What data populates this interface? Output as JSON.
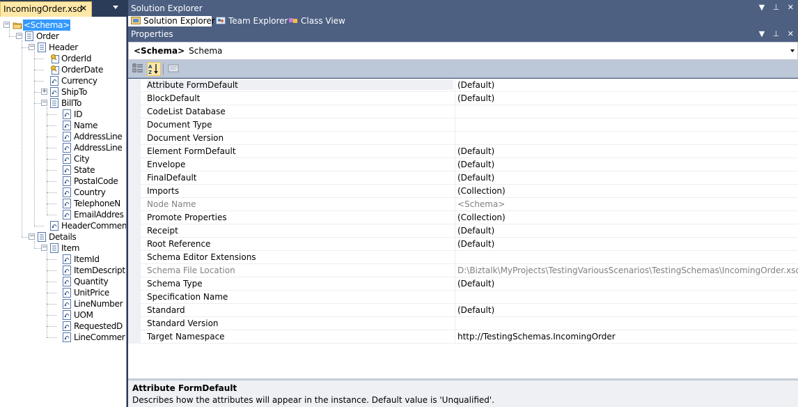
{
  "document": {
    "tab_label": "IncomingOrder.xsd",
    "tab_close": "✕"
  },
  "tree": [
    {
      "label": "<Schema>",
      "icon": "schema-folder-icon",
      "toggle": "−",
      "selected": true
    },
    {
      "label": "Order",
      "icon": "record-icon",
      "toggle": "−"
    },
    {
      "label": "Header",
      "icon": "record-icon",
      "toggle": "−"
    },
    {
      "label": "OrderId",
      "icon": "key-field-icon"
    },
    {
      "label": "OrderDate",
      "icon": "key-field-icon"
    },
    {
      "label": "Currency",
      "icon": "field-element-icon"
    },
    {
      "label": "ShipTo",
      "icon": "field-element-icon",
      "toggle": "+"
    },
    {
      "label": "BillTo",
      "icon": "record-icon",
      "toggle": "−"
    },
    {
      "label": "ID",
      "icon": "field-element-icon"
    },
    {
      "label": "Name",
      "icon": "field-element-icon"
    },
    {
      "label": "AddressLine",
      "icon": "field-element-icon"
    },
    {
      "label": "AddressLine",
      "icon": "field-element-icon"
    },
    {
      "label": "City",
      "icon": "field-element-icon"
    },
    {
      "label": "State",
      "icon": "field-element-icon"
    },
    {
      "label": "PostalCode",
      "icon": "field-element-icon"
    },
    {
      "label": "Country",
      "icon": "field-element-icon"
    },
    {
      "label": "TelephoneN",
      "icon": "field-element-icon"
    },
    {
      "label": "EmailAddres",
      "icon": "field-element-icon"
    },
    {
      "label": "HeaderComment",
      "icon": "field-element-icon"
    },
    {
      "label": "Details",
      "icon": "record-icon",
      "toggle": "−"
    },
    {
      "label": "Item",
      "icon": "record-icon",
      "toggle": "−"
    },
    {
      "label": "ItemId",
      "icon": "field-element-icon"
    },
    {
      "label": "ItemDescript",
      "icon": "field-element-icon"
    },
    {
      "label": "Quantity",
      "icon": "field-element-icon"
    },
    {
      "label": "UnitPrice",
      "icon": "field-element-icon"
    },
    {
      "label": "LineNumber",
      "icon": "field-element-icon"
    },
    {
      "label": "UOM",
      "icon": "field-element-icon"
    },
    {
      "label": "RequestedD",
      "icon": "field-element-icon"
    },
    {
      "label": "LineCommer",
      "icon": "field-element-icon"
    }
  ],
  "solution_explorer": {
    "title": "Solution Explorer",
    "tabs": [
      {
        "label": "Solution Explorer",
        "icon": "solution-icon",
        "active": true
      },
      {
        "label": "Team Explorer",
        "icon": "team-explorer-icon",
        "active": false
      },
      {
        "label": "Class View",
        "icon": "class-view-icon",
        "active": false
      }
    ],
    "buttons": {
      "dropdown": "▼",
      "pin": "⊥",
      "close": "✕"
    }
  },
  "properties": {
    "title": "Properties",
    "buttons": {
      "dropdown": "▼",
      "pin": "⊥",
      "close": "✕"
    },
    "object_selector": {
      "type": "<Schema>",
      "name": "Schema"
    },
    "toolbar": {
      "categorized": {
        "icon": "categorized-icon"
      },
      "alphabetical": {
        "icon": "alphabetical-icon",
        "active": true
      },
      "property_pages": {
        "icon": "property-pages-icon"
      }
    },
    "rows": [
      {
        "name": "Attribute FormDefault",
        "value": "(Default)",
        "selected": true
      },
      {
        "name": "BlockDefault",
        "value": "(Default)"
      },
      {
        "name": "CodeList Database",
        "value": ""
      },
      {
        "name": "Document Type",
        "value": ""
      },
      {
        "name": "Document Version",
        "value": ""
      },
      {
        "name": "Element FormDefault",
        "value": "(Default)"
      },
      {
        "name": "Envelope",
        "value": "(Default)"
      },
      {
        "name": "FinalDefault",
        "value": "(Default)"
      },
      {
        "name": "Imports",
        "value": "(Collection)"
      },
      {
        "name": "Node Name",
        "value": "<Schema>",
        "readonly": true
      },
      {
        "name": "Promote Properties",
        "value": "(Collection)"
      },
      {
        "name": "Receipt",
        "value": "(Default)"
      },
      {
        "name": "Root Reference",
        "value": "(Default)"
      },
      {
        "name": "Schema Editor Extensions",
        "value": ""
      },
      {
        "name": "Schema File Location",
        "value": "D:\\Biztalk\\MyProjects\\TestingVariousScenarios\\TestingSchemas\\IncomingOrder.xsd",
        "readonly": true
      },
      {
        "name": "Schema Type",
        "value": "(Default)"
      },
      {
        "name": "Specification Name",
        "value": ""
      },
      {
        "name": "Standard",
        "value": "(Default)"
      },
      {
        "name": "Standard Version",
        "value": ""
      },
      {
        "name": "Target Namespace",
        "value": "http://TestingSchemas.IncomingOrder"
      }
    ],
    "description": {
      "title": "Attribute FormDefault",
      "text": "Describes how the attributes will appear in the instance. Default value is 'Unqualified'."
    }
  }
}
